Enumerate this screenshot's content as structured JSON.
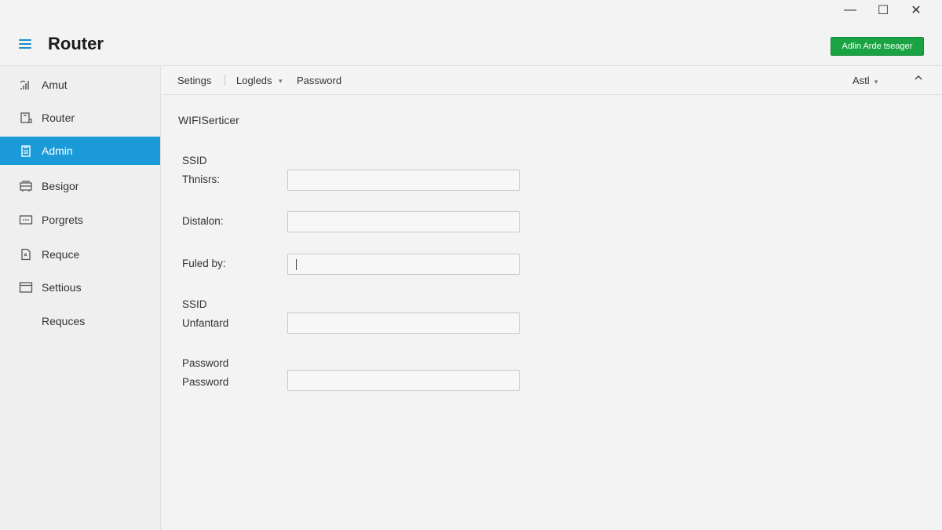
{
  "app": {
    "title": "Router",
    "action_button": "Adlin Arde tseager"
  },
  "window_controls": {
    "minimize": "—",
    "maximize": "☐",
    "close": "✕"
  },
  "sidebar": {
    "items": [
      {
        "label": "Amut",
        "icon": "wifi-signal-icon",
        "active": false
      },
      {
        "label": "Router",
        "icon": "router-device-icon",
        "active": false
      },
      {
        "label": "Admin",
        "icon": "clipboard-icon",
        "active": true
      },
      {
        "label": "Besigor",
        "icon": "rack-icon",
        "active": false
      },
      {
        "label": "Porgrets",
        "icon": "terminal-icon",
        "active": false
      },
      {
        "label": "Requce",
        "icon": "document-icon",
        "active": false
      },
      {
        "label": "Settious",
        "icon": "window-icon",
        "active": false
      },
      {
        "label": "Requces",
        "icon": "",
        "active": false
      }
    ]
  },
  "tabs": {
    "items": [
      "Setings",
      "Logleds",
      "Password"
    ],
    "right_menu": "Astl"
  },
  "form": {
    "section_title": "WIFISerticer",
    "groups": [
      {
        "heading": "SSID",
        "label": "Thnisrs:",
        "value": ""
      },
      {
        "heading": "",
        "label": "Distalon:",
        "value": ""
      },
      {
        "heading": "",
        "label": "Fuled by:",
        "value": ""
      },
      {
        "heading": "SSID",
        "label": "Unfantard",
        "value": ""
      },
      {
        "heading": "Password",
        "label": "Password",
        "value": ""
      }
    ]
  }
}
